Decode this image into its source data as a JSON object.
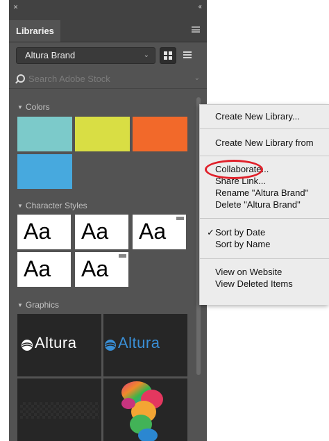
{
  "panel": {
    "close_glyph": "×",
    "collapse_glyph": "‹‹",
    "tab_label": "Libraries",
    "library_select_value": "Altura Brand",
    "search_placeholder": "Search Adobe Stock",
    "sections": {
      "colors": "Colors",
      "character_styles": "Character Styles",
      "graphics": "Graphics"
    },
    "colors": [
      "#7ccaca",
      "#d9de44",
      "#f2692a",
      "#47a9de"
    ],
    "character_style_sample": "Aa",
    "graphics": {
      "logo_text": "Altura",
      "logo_white_color": "#ffffff",
      "logo_blue_color": "#3a8fd6"
    }
  },
  "context_menu": {
    "items": {
      "create_new_library": "Create New Library...",
      "create_new_library_from": "Create New Library from",
      "collaborate": "Collaborate...",
      "share_link": "Share Link...",
      "rename": "Rename \"Altura Brand\"",
      "delete": "Delete \"Altura Brand\"",
      "sort_by_date": "Sort by Date",
      "sort_by_name": "Sort by Name",
      "view_on_website": "View on Website",
      "view_deleted_items": "View Deleted Items"
    },
    "checked_item": "sort_by_date",
    "check_glyph": "✓",
    "highlight_color": "#e0202a"
  }
}
